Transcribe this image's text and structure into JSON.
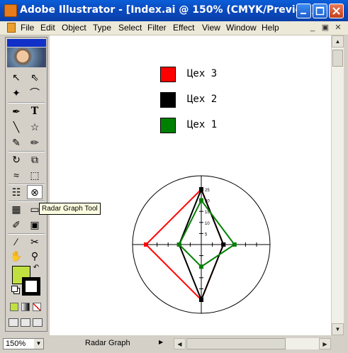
{
  "window": {
    "title": "Adobe Illustrator - [Index.ai @ 150% (CMYK/Preview) ]"
  },
  "menu": {
    "items": [
      "File",
      "Edit",
      "Object",
      "Type",
      "Select",
      "Filter",
      "Effect",
      "View",
      "Window",
      "Help"
    ]
  },
  "toolbox": {
    "tooltip": "Radar Graph Tool",
    "selected_tool": "radar-graph-tool",
    "fill_color": "#c0e040",
    "stroke_color": "#000000"
  },
  "legend": [
    {
      "label": "Цех 3",
      "color": "#ff0000"
    },
    {
      "label": "Цех 2",
      "color": "#000000"
    },
    {
      "label": "Цех 1",
      "color": "#008000"
    }
  ],
  "chart_data": {
    "type": "radar",
    "axis_ticks": [
      "5",
      "10",
      "15",
      "20",
      "25"
    ],
    "rmax": 25,
    "series": [
      {
        "color": "#ff0000",
        "values": [
          25,
          10,
          25,
          25
        ]
      },
      {
        "color": "#000000",
        "values": [
          25,
          10,
          25,
          10
        ]
      },
      {
        "color": "#008000",
        "values": [
          20,
          15,
          10,
          10
        ]
      }
    ]
  },
  "status": {
    "zoom": "150%",
    "tool_name": "Radar Graph"
  }
}
